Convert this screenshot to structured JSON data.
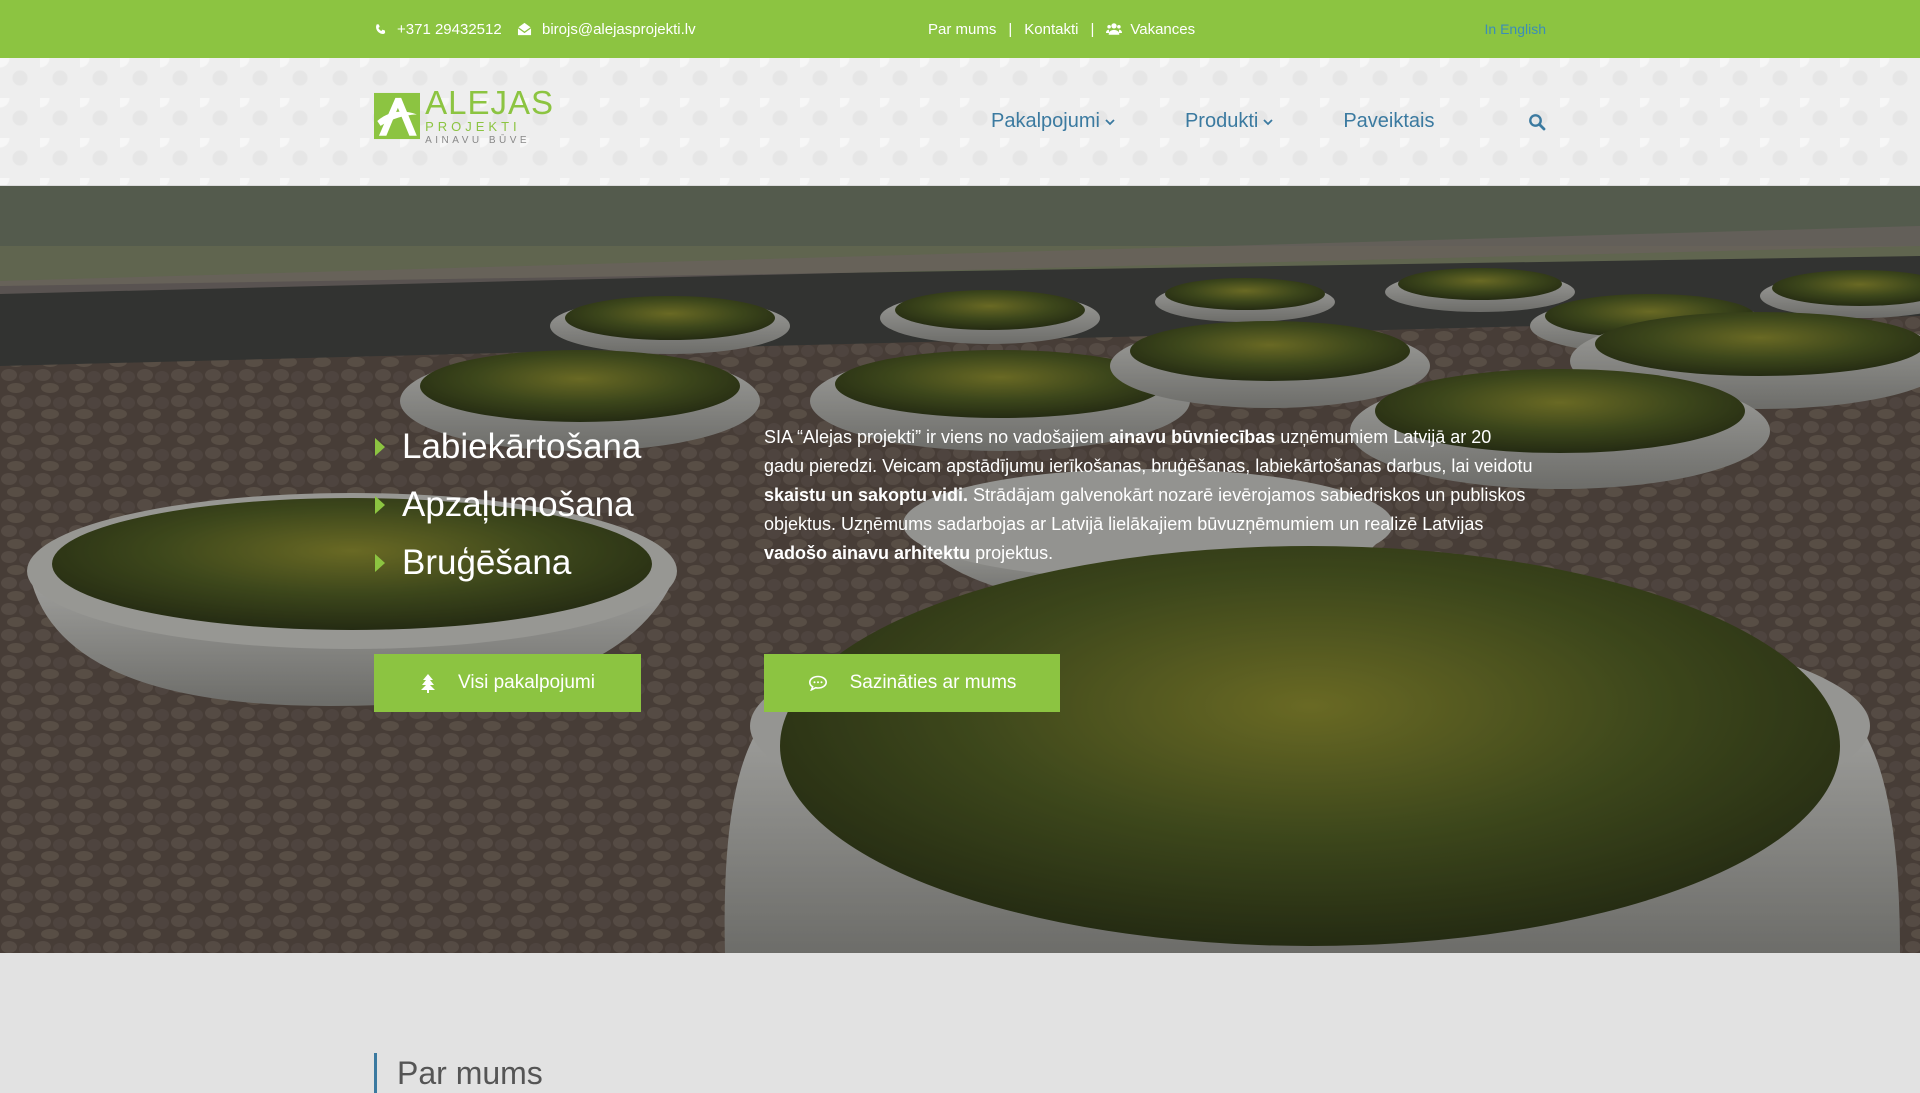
{
  "topbar": {
    "phone": "+371 29432512",
    "email": "birojs@alejasprojekti.lv",
    "links": [
      {
        "label": "Par mums"
      },
      {
        "label": "Kontakti"
      },
      {
        "label": "Vakances"
      }
    ],
    "separator": "|",
    "language": "In English",
    "icons": [
      "phone-icon",
      "envelope-icon",
      "users-icon"
    ]
  },
  "header": {
    "logo": {
      "main": "ALEJAS",
      "sub": "PROJEKTI",
      "tagline": "AINAVU BŪVE"
    },
    "nav": [
      {
        "label": "Pakalpojumi",
        "has_dropdown": true
      },
      {
        "label": "Produkti",
        "has_dropdown": true
      },
      {
        "label": "Paveiktais",
        "has_dropdown": false
      }
    ],
    "search_icon": "search-icon"
  },
  "hero": {
    "services": [
      "Labiekārtošana",
      "Apzaļumošana",
      "Bruģēšana"
    ],
    "intro": {
      "p1": "SIA “Alejas projekti” ir viens no vadošajiem ",
      "b1": "ainavu būvniecības",
      "p2": " uzņēmumiem Latvijā ar 20 gadu pieredzi. Veicam apstādījumu ierīkošanas, bruģēšanas, labiekārtošanas darbus, lai veidotu ",
      "b2": "skaistu un sakoptu vidi.",
      "p3": " Strādājam galvenokārt nozarē ievērojamos sabiedriskos un publiskos objektus. Uzņēmums sadarbojas ar Latvijā lielākajiem būvuzņēmumiem un realizē Latvijas ",
      "b3": "vadošo ainavu arhitektu",
      "p4": " projektus."
    },
    "buttons": {
      "services": "Visi pakalpojumi",
      "contact": "Sazināties ar mums"
    }
  },
  "about": {
    "title": "Par mums"
  },
  "colors": {
    "accent_green": "#8cc441",
    "nav_blue": "#3b7aa0",
    "language_blue": "#3b8db8",
    "header_bg": "#eeeeee",
    "page_bg": "#e2e2e2"
  }
}
